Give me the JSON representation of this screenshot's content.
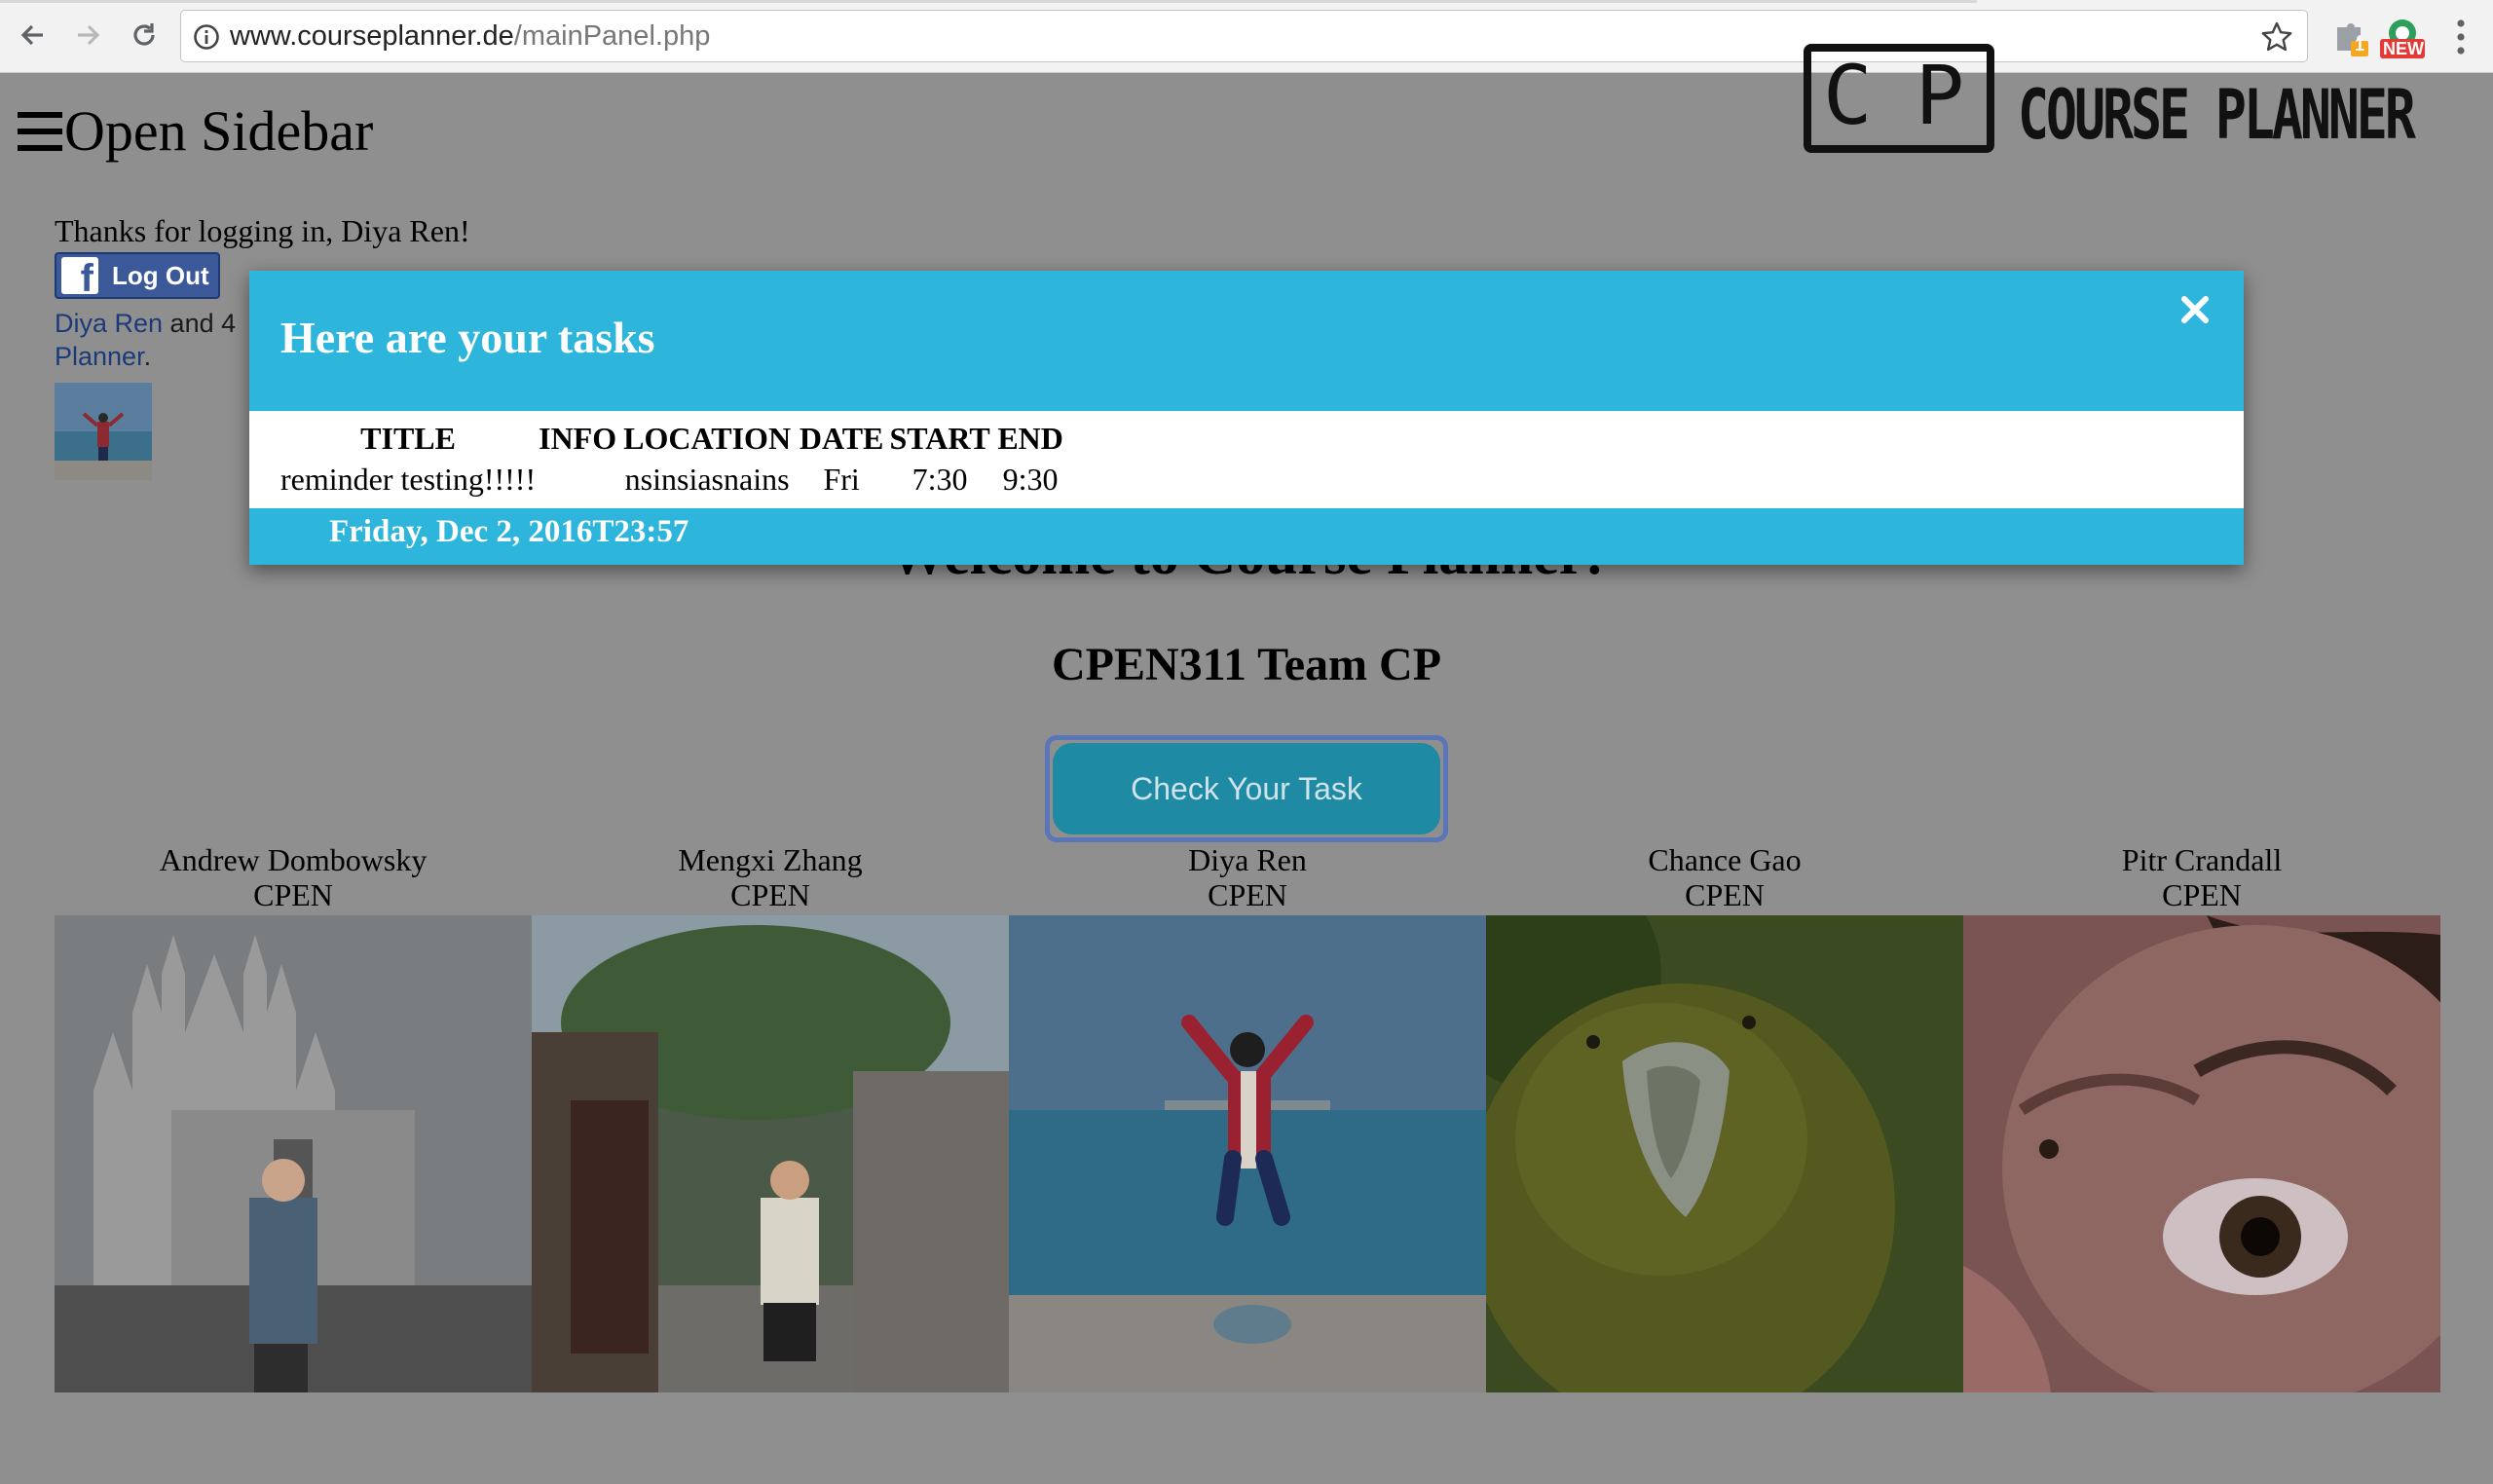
{
  "browser": {
    "url_host": "www.courseplanner.de",
    "url_path": "/mainPanel.php",
    "extension_badge": "1",
    "new_badge": "NEW"
  },
  "page": {
    "open_sidebar_label": "Open Sidebar",
    "logo_letters": "CP",
    "logo_text": "COURSE PLANNER",
    "thanks_text": "Thanks for logging in, Diya Ren!",
    "logout_label": "Log Out",
    "friends": {
      "name": "Diya Ren",
      "middle": " and 4",
      "app": "Planner",
      "end": "."
    },
    "welcome": "Welcome to Course Planner!",
    "team": "CPEN311 Team CP",
    "check_task_label": "Check Your Task",
    "members": [
      {
        "name": "Andrew Dombowsky",
        "major": "CPEN"
      },
      {
        "name": "Mengxi Zhang",
        "major": "CPEN"
      },
      {
        "name": "Diya Ren",
        "major": "CPEN"
      },
      {
        "name": "Chance Gao",
        "major": "CPEN"
      },
      {
        "name": "Pitr Crandall",
        "major": "CPEN"
      }
    ]
  },
  "modal": {
    "title": "Here are your tasks",
    "columns": [
      "TITLE",
      "INFO",
      "LOCATION",
      "DATE",
      "START",
      "END"
    ],
    "rows": [
      {
        "title": "reminder testing!!!!!",
        "info": "",
        "location": "nsinsiasnains",
        "date": "Fri",
        "start": "7:30",
        "end": "9:30"
      }
    ],
    "footer_date": "Friday, Dec 2, 2016T23:57"
  },
  "colors": {
    "modal_accent": "#2db5db",
    "facebook_blue": "#3b5998",
    "button_teal": "#1f8aa4",
    "overlay_gray": "#8f8f8f"
  }
}
